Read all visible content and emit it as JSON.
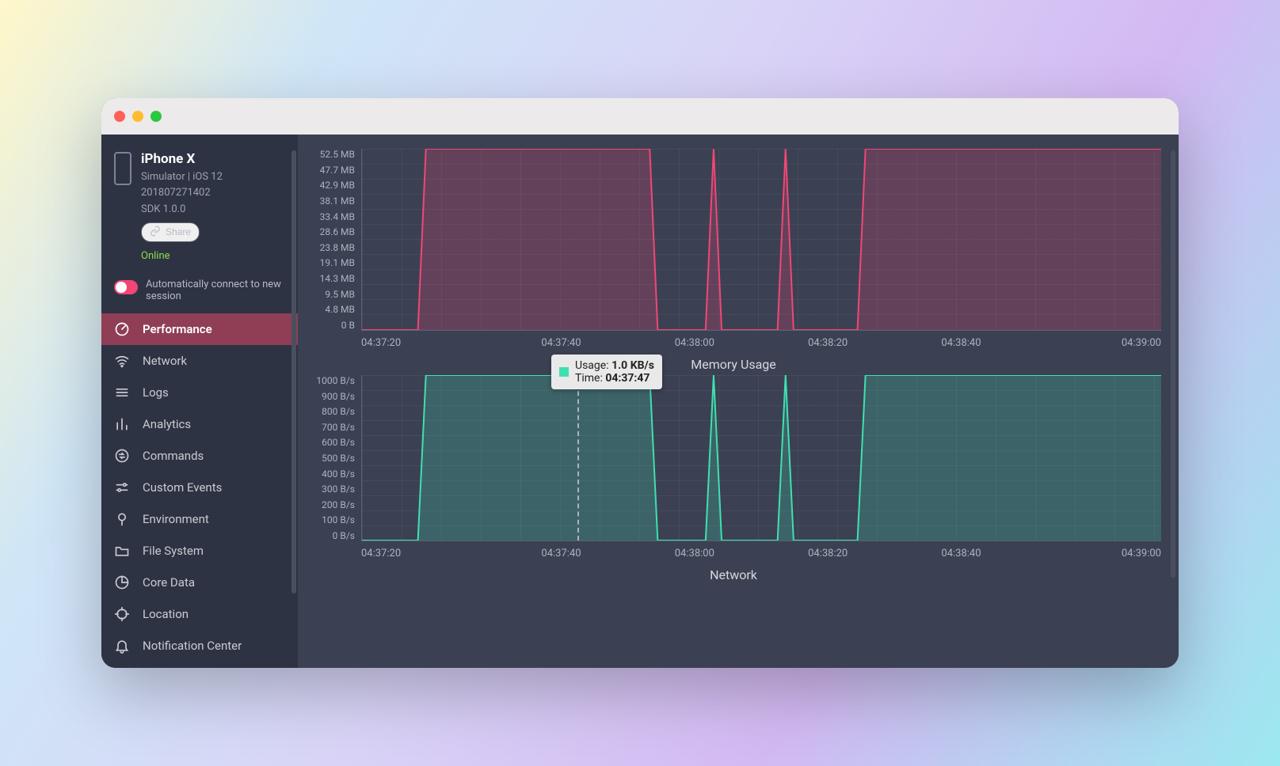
{
  "device": {
    "name": "iPhone X",
    "caption": "Simulator | iOS 12",
    "build": "201807271402",
    "sdk": "SDK 1.0.0",
    "share_label": "Share",
    "status": "Online",
    "auto_connect_label": "Automatically connect to new session"
  },
  "sidebar": {
    "items": [
      {
        "id": "performance",
        "label": "Performance",
        "icon": "gauge",
        "active": true
      },
      {
        "id": "network",
        "label": "Network",
        "icon": "wifi"
      },
      {
        "id": "logs",
        "label": "Logs",
        "icon": "lines"
      },
      {
        "id": "analytics",
        "label": "Analytics",
        "icon": "bars"
      },
      {
        "id": "commands",
        "label": "Commands",
        "icon": "swap"
      },
      {
        "id": "custom-events",
        "label": "Custom Events",
        "icon": "sliders"
      },
      {
        "id": "environment",
        "label": "Environment",
        "icon": "pin"
      },
      {
        "id": "file-system",
        "label": "File System",
        "icon": "folder"
      },
      {
        "id": "core-data",
        "label": "Core Data",
        "icon": "pie"
      },
      {
        "id": "location",
        "label": "Location",
        "icon": "crosshair"
      },
      {
        "id": "notification-center",
        "label": "Notification Center",
        "icon": "bell"
      }
    ]
  },
  "tooltip": {
    "usage_label": "Usage:",
    "usage_value": "1.0 KB/s",
    "time_label": "Time:",
    "time_value": "04:37:47"
  },
  "chart_data": [
    {
      "type": "area",
      "title": "Memory Usage",
      "xlabel": "",
      "ylabel": "",
      "x_ticks": [
        "04:37:20",
        "04:37:40",
        "04:38:00",
        "04:38:20",
        "04:39:00"
      ],
      "x_tick_extra": "04:38:40",
      "y_ticks": [
        "52.5 MB",
        "47.7 MB",
        "42.9 MB",
        "38.1 MB",
        "33.4 MB",
        "28.6 MB",
        "23.8 MB",
        "19.1 MB",
        "14.3 MB",
        "9.5 MB",
        "4.8 MB",
        "0 B"
      ],
      "ylim": [
        0,
        52.5
      ],
      "color": "#f24675",
      "series": [
        {
          "name": "memory",
          "unit": "MB",
          "points_time_value": [
            [
              "04:37:20",
              0
            ],
            [
              "04:37:27",
              0
            ],
            [
              "04:37:28",
              52.5
            ],
            [
              "04:37:56",
              52.5
            ],
            [
              "04:37:57",
              0
            ],
            [
              "04:38:03",
              0
            ],
            [
              "04:38:04",
              52.5
            ],
            [
              "04:38:05",
              0
            ],
            [
              "04:38:12",
              0
            ],
            [
              "04:38:13",
              52.5
            ],
            [
              "04:38:14",
              0
            ],
            [
              "04:38:22",
              0
            ],
            [
              "04:38:23",
              52.5
            ],
            [
              "04:39:00",
              52.5
            ]
          ]
        }
      ]
    },
    {
      "type": "area",
      "title": "Network",
      "xlabel": "",
      "ylabel": "",
      "x_ticks": [
        "04:37:20",
        "04:37:40",
        "04:38:00",
        "04:38:20",
        "04:39:00"
      ],
      "x_tick_extra": "04:38:40",
      "y_ticks": [
        "1000 B/s",
        "900 B/s",
        "800 B/s",
        "700 B/s",
        "600 B/s",
        "500 B/s",
        "400 B/s",
        "300 B/s",
        "200 B/s",
        "100 B/s",
        "0 B/s"
      ],
      "ylim": [
        0,
        1000
      ],
      "color": "#3fe0b0",
      "hover_time": "04:37:47",
      "series": [
        {
          "name": "network",
          "unit": "B/s",
          "points_time_value": [
            [
              "04:37:20",
              0
            ],
            [
              "04:37:27",
              0
            ],
            [
              "04:37:28",
              1000
            ],
            [
              "04:37:56",
              1000
            ],
            [
              "04:37:57",
              0
            ],
            [
              "04:38:03",
              0
            ],
            [
              "04:38:04",
              1000
            ],
            [
              "04:38:05",
              0
            ],
            [
              "04:38:12",
              0
            ],
            [
              "04:38:13",
              1000
            ],
            [
              "04:38:14",
              0
            ],
            [
              "04:38:22",
              0
            ],
            [
              "04:38:23",
              1000
            ],
            [
              "04:39:00",
              1000
            ]
          ]
        }
      ]
    }
  ]
}
